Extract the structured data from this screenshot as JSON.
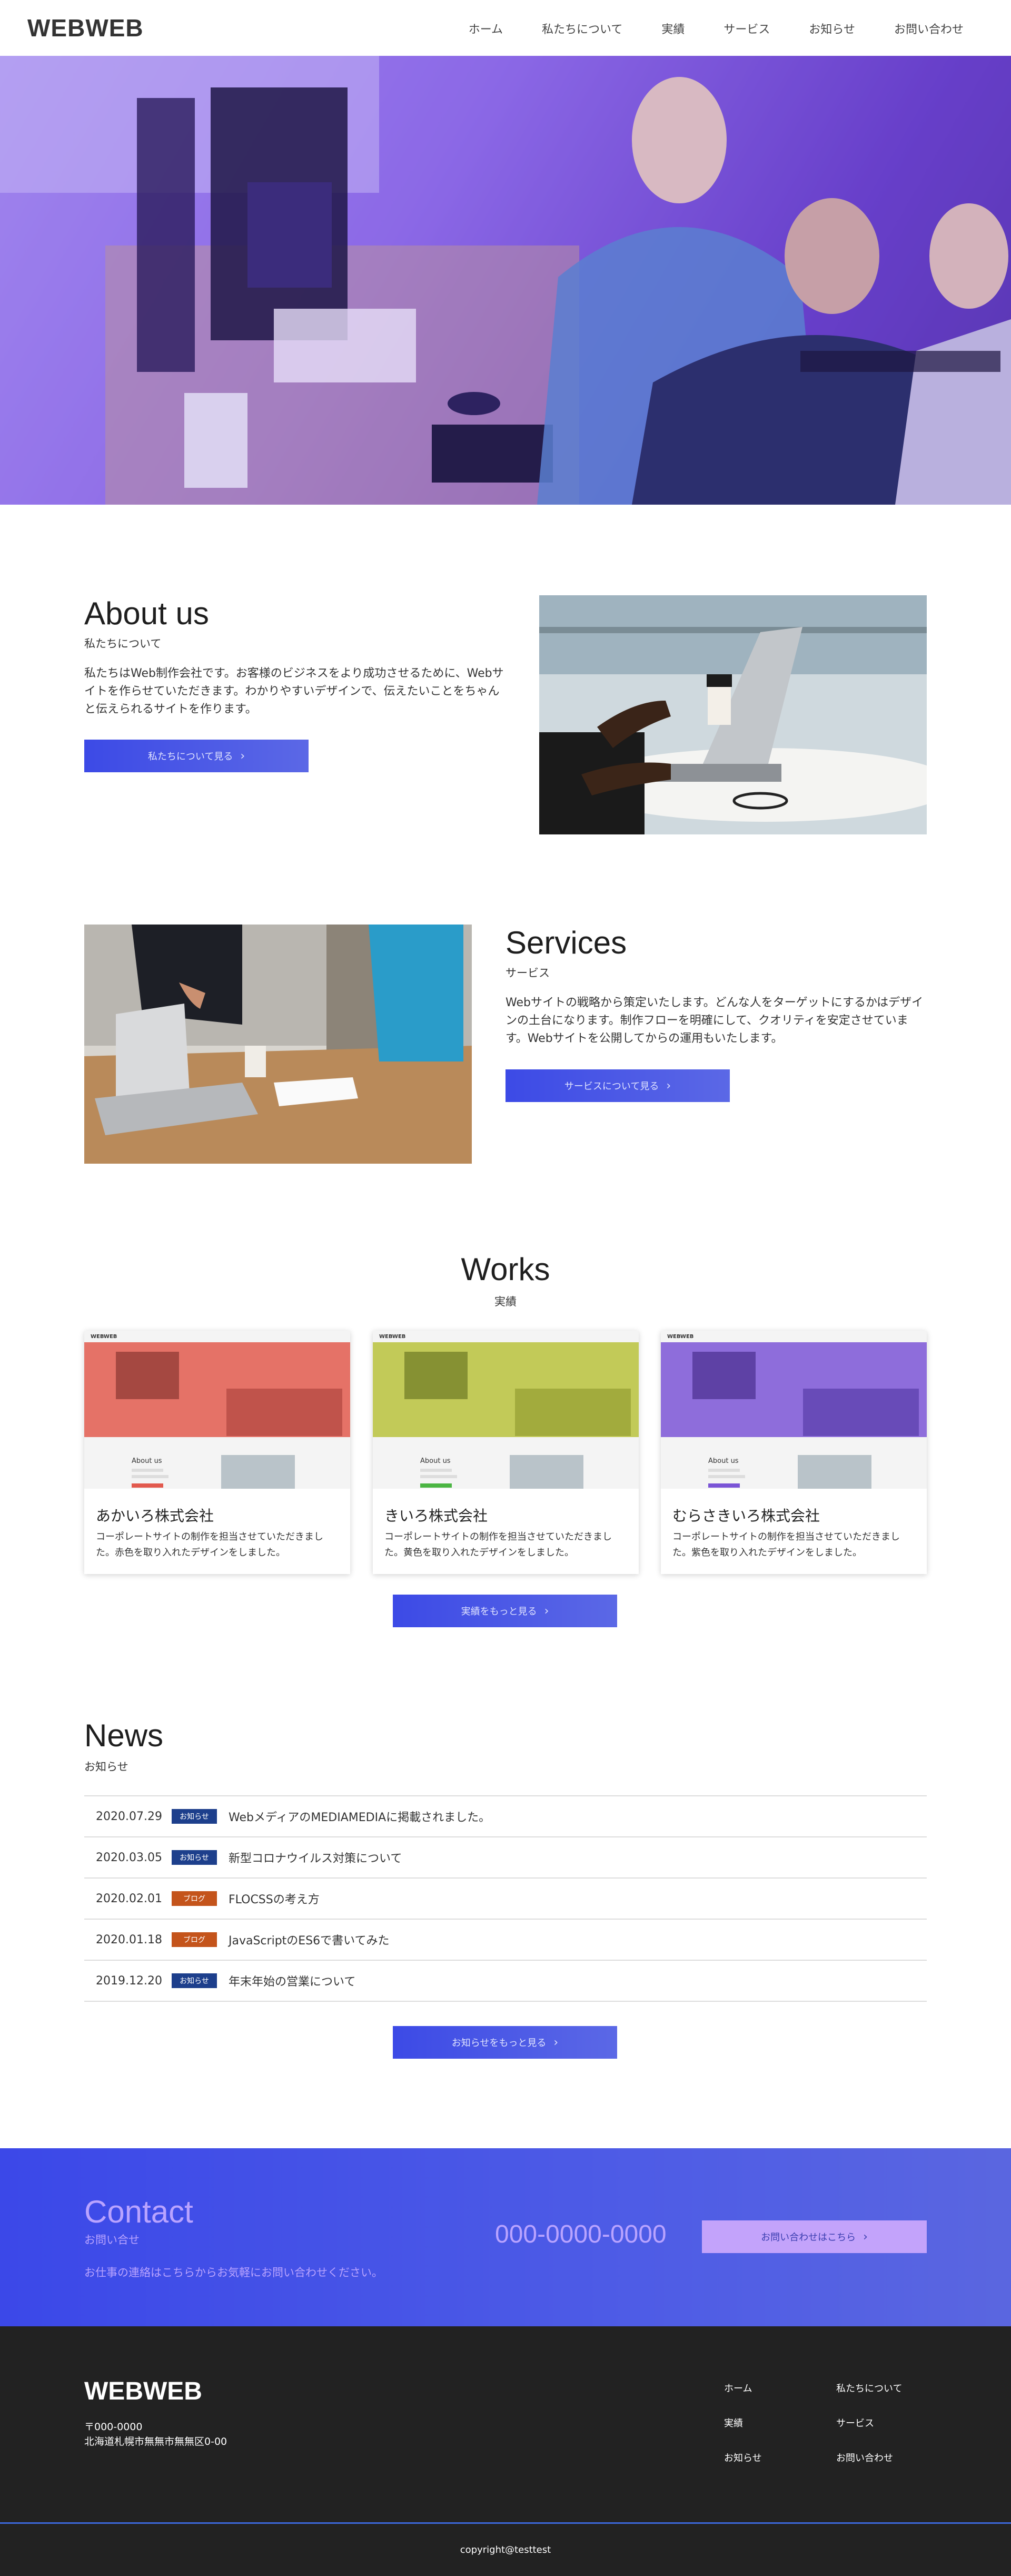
{
  "header": {
    "logo": "WEBWEB",
    "nav": [
      "ホーム",
      "私たちについて",
      "実績",
      "サービス",
      "お知らせ",
      "お問い合わせ"
    ]
  },
  "about": {
    "title": "About us",
    "subtitle": "私たちについて",
    "body": "私たちはWeb制作会社です。お客様のビジネスをより成功させるために、Webサイトを作らせていただきます。わかりやすいデザインで、伝えたいことをちゃんと伝えられるサイトを作ります。",
    "button": "私たちについて見る",
    "arrow": "›"
  },
  "services": {
    "title": "Services",
    "subtitle": "サービス",
    "body": "Webサイトの戦略から策定いたします。どんな人をターゲットにするかはデザインの土台になります。制作フローを明確にして、クオリティを安定させています。Webサイトを公開してからの運用もいたします。",
    "button": "サービスについて見る",
    "arrow": "›"
  },
  "works": {
    "title": "Works",
    "subtitle": "実績",
    "button": "実績をもっと見る",
    "arrow": "›",
    "thumb_logo": "WEBWEB",
    "thumb_heading": "About us",
    "items": [
      {
        "name": "あかいろ株式会社",
        "desc": "コーポレートサイトの制作を担当させていただきました。赤色を取り入れたデザインをしました。",
        "tint": "#e25a4e"
      },
      {
        "name": "きいろ株式会社",
        "desc": "コーポレートサイトの制作を担当させていただきました。黄色を取り入れたデザインをしました。",
        "tint": "#b8c23c"
      },
      {
        "name": "むらさきいろ株式会社",
        "desc": "コーポレートサイトの制作を担当させていただきました。紫色を取り入れたデザインをしました。",
        "tint": "#7b55d6"
      }
    ]
  },
  "news": {
    "title": "News",
    "subtitle": "お知らせ",
    "button": "お知らせをもっと見る",
    "arrow": "›",
    "rows": [
      {
        "date": "2020.07.29",
        "tag": "お知らせ",
        "title": "WebメディアのMEDIAMEDIAに掲載されました。",
        "tag_color": "#1d3f8c"
      },
      {
        "date": "2020.03.05",
        "tag": "お知らせ",
        "title": "新型コロナウイルス対策について",
        "tag_color": "#1d3f8c"
      },
      {
        "date": "2020.02.01",
        "tag": "ブログ",
        "title": "FLOCSSの考え方",
        "tag_color": "#c4541b"
      },
      {
        "date": "2020.01.18",
        "tag": "ブログ",
        "title": "JavaScriptのES6で書いてみた",
        "tag_color": "#c4541b"
      },
      {
        "date": "2019.12.20",
        "tag": "お知らせ",
        "title": "年末年始の営業について",
        "tag_color": "#1d3f8c"
      }
    ]
  },
  "contact": {
    "title": "Contact",
    "subtitle": "お問い合せ",
    "body": "お仕事の連絡はこちらからお気軽にお問い合わせください。",
    "phone": "000-0000-0000",
    "button": "お問い合わせはこちら",
    "arrow": "›"
  },
  "footer": {
    "logo": "WEBWEB",
    "postal": "〒000-0000",
    "address": "北海道札幌市無無市無無区0-00",
    "links": [
      "ホーム",
      "私たちについて",
      "実績",
      "サービス",
      "お知らせ",
      "お問い合わせ"
    ],
    "copyright": "copyright@testtest"
  },
  "colors": {
    "accent": "#4150e6",
    "footer": "#222222"
  }
}
